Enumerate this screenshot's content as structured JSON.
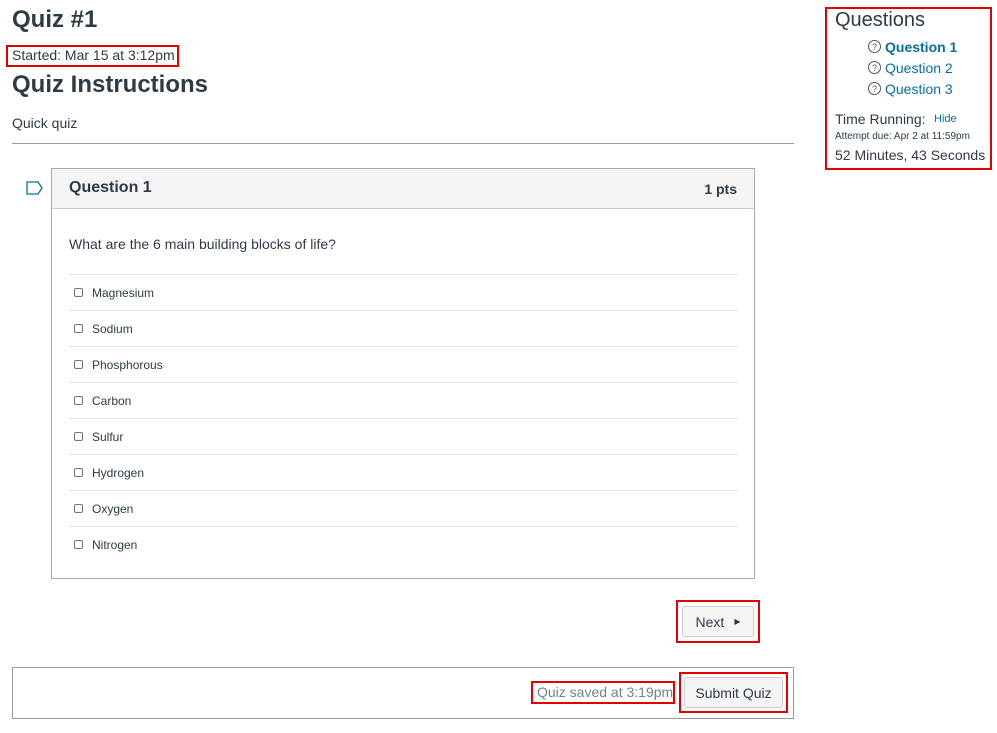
{
  "header": {
    "title": "Quiz #1",
    "started": "Started: Mar 15 at 3:12pm",
    "instructions_heading": "Quiz Instructions",
    "instructions_text": "Quick quiz"
  },
  "question": {
    "name": "Question 1",
    "points": "1 pts",
    "text": "What are the 6 main building blocks of life?",
    "answers": [
      {
        "label": "Magnesium",
        "checked": false
      },
      {
        "label": "Sodium",
        "checked": false
      },
      {
        "label": "Phosphorous",
        "checked": false
      },
      {
        "label": "Carbon",
        "checked": false
      },
      {
        "label": "Sulfur",
        "checked": false
      },
      {
        "label": "Hydrogen",
        "checked": false
      },
      {
        "label": "Oxygen",
        "checked": false
      },
      {
        "label": "Nitrogen",
        "checked": false
      }
    ]
  },
  "navigation": {
    "next_label": "Next",
    "next_icon": "triangle-right-icon"
  },
  "footer": {
    "saved_text": "Quiz saved at 3:19pm",
    "submit_label": "Submit Quiz"
  },
  "sidebar": {
    "title": "Questions",
    "questions": [
      {
        "label": "Question 1",
        "current": true,
        "icon": "question-circle-icon"
      },
      {
        "label": "Question 2",
        "current": false,
        "icon": "question-circle-icon"
      },
      {
        "label": "Question 3",
        "current": false,
        "icon": "question-circle-icon"
      }
    ],
    "time_label": "Time Running:",
    "hide_label": "Hide",
    "due_text": "Attempt due: Apr 2 at 11:59pm",
    "timer": "52 Minutes, 43 Seconds"
  },
  "colors": {
    "highlight_border": "#e30000",
    "link": "#0770a3",
    "text": "#2d3b45"
  }
}
